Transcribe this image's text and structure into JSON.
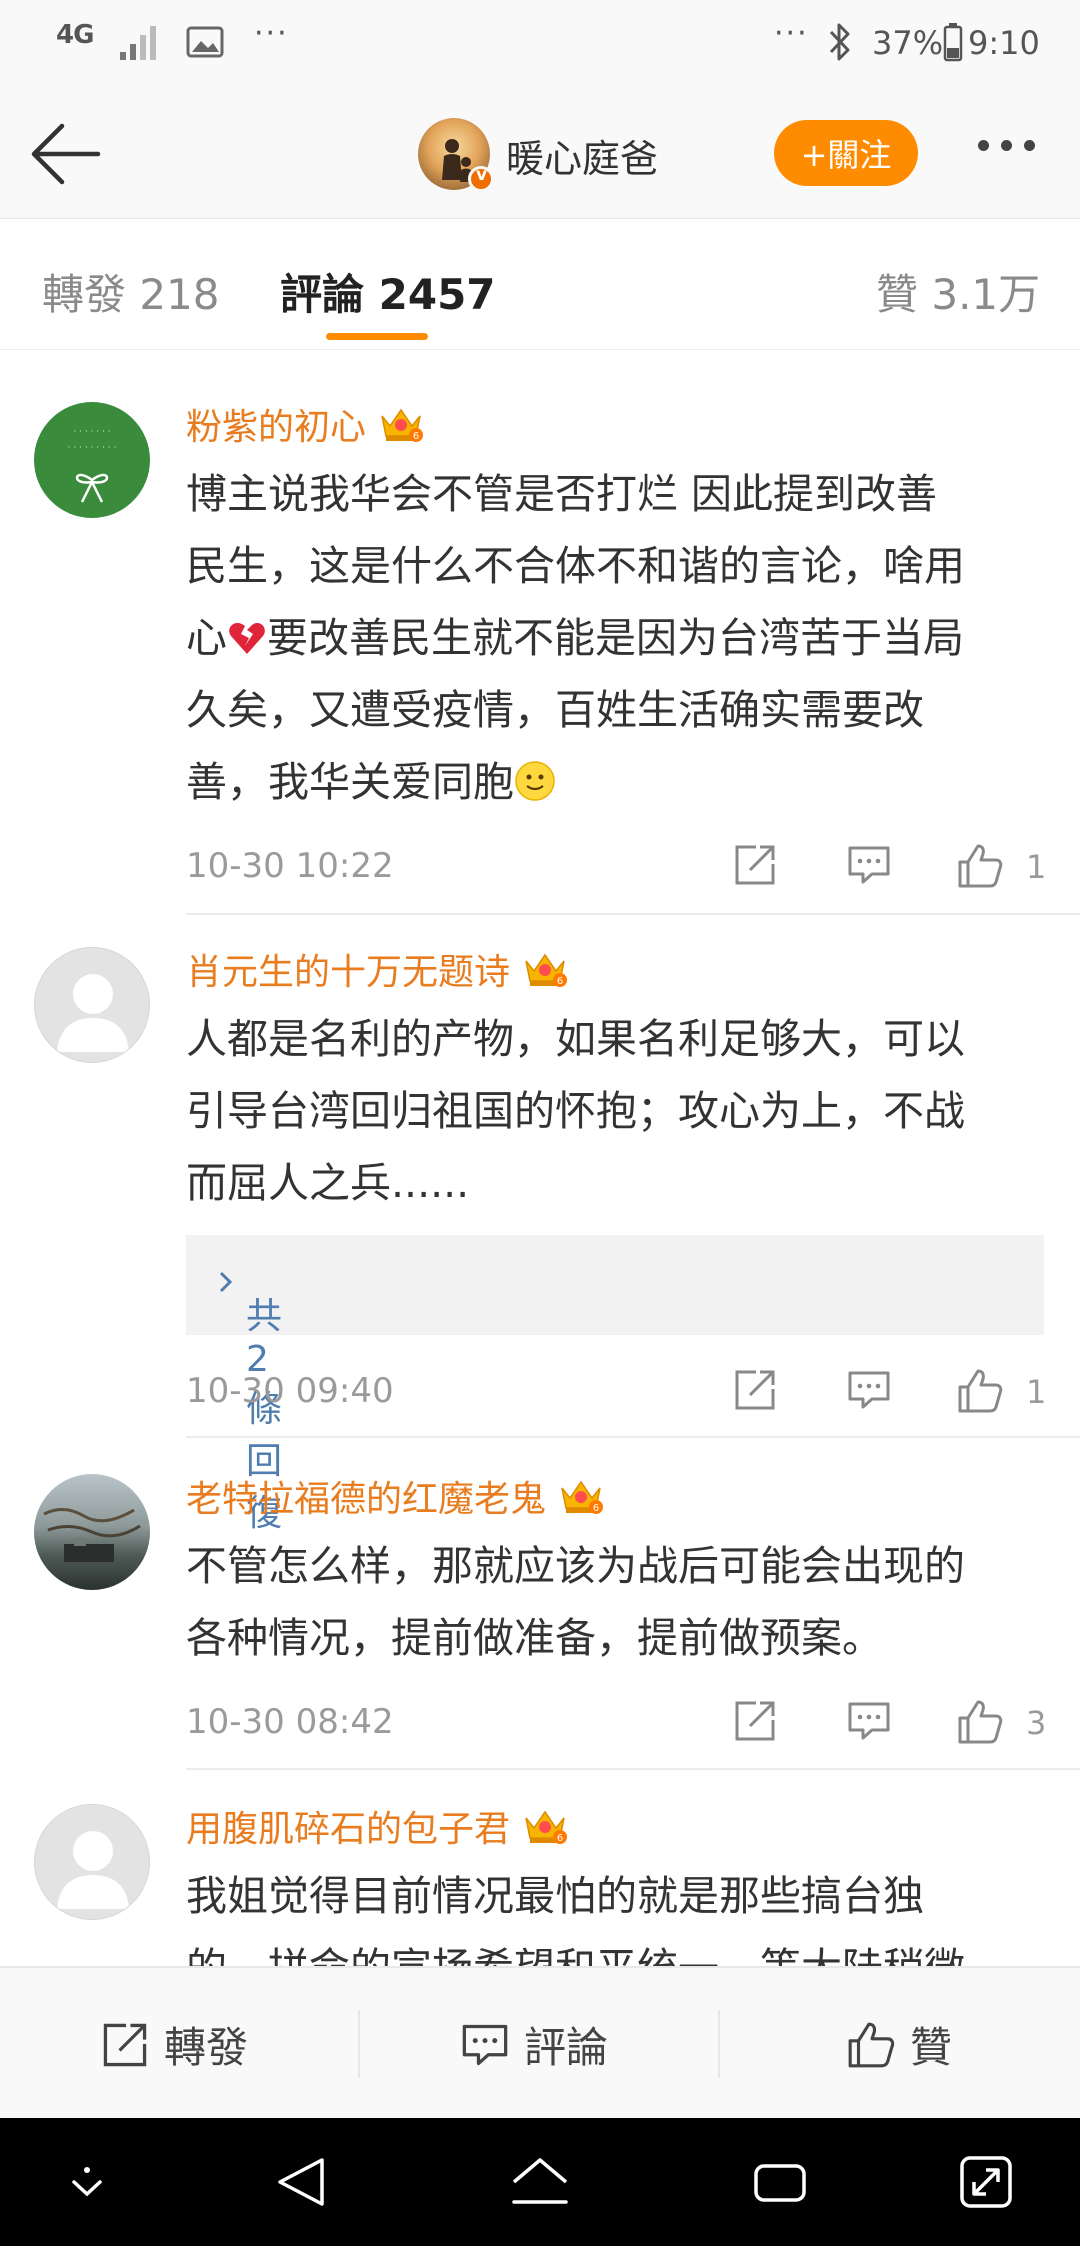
{
  "status_bar": {
    "network": "4G",
    "dots_left": "···",
    "dots_right": "···",
    "battery": "37%",
    "time": "9:10"
  },
  "header": {
    "title": "暖心庭爸",
    "follow_label": "+關注"
  },
  "tabs": {
    "repost": "轉發 218",
    "comments": "評論 2457",
    "likes": "贊 3.1万"
  },
  "comments": [
    {
      "username": "粉紫的初心",
      "line1": "博主说我华会不管是否打烂 因此提到改善",
      "line2": "民生，这是什么不合体不和谐的言论，啥用",
      "line3a": "心",
      "line3b": "要改善民生就不能是因为台湾苦于当局",
      "line4": "久矣，又遭受疫情，百姓生活确实需要改",
      "line5": "善，我华关爱同胞",
      "time": "10-30 10:22",
      "likes": "1"
    },
    {
      "username": "肖元生的十万无题诗",
      "line1": "人都是名利的产物，如果名利足够大，可以",
      "line2": "引导台湾回归祖国的怀抱；攻心为上，不战",
      "line3": "而屈人之兵......",
      "replies": "共2條回復",
      "time": "10-30 09:40",
      "likes": "1"
    },
    {
      "username": "老特拉福德的红魔老鬼",
      "line1": "不管怎么样，那就应该为战后可能会出现的",
      "line2": "各种情况，提前做准备，提前做预案。",
      "time": "10-30 08:42",
      "likes": "3"
    },
    {
      "username": "用腹肌碎石的包子君",
      "line1": "我姐觉得目前情况最怕的就是那些搞台独",
      "line2": "的，拼命的宣扬希望和平统一，等大陆稍微"
    }
  ],
  "bottom_bar": {
    "repost": "轉發",
    "comment": "評論",
    "like": "贊"
  },
  "colors": {
    "accent": "#ff8c00",
    "username": "#e87c1e",
    "link": "#507daf"
  }
}
